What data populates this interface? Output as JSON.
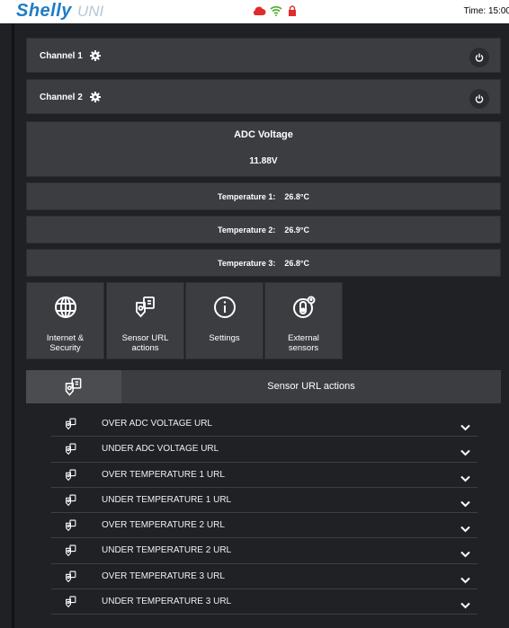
{
  "header": {
    "logo": "Shelly",
    "product": "UNI",
    "status_icons": [
      "cloud-icon",
      "wifi-icon",
      "lock-icon"
    ],
    "time_label": "Time: 15:00"
  },
  "channels": [
    {
      "label": "Channel 1"
    },
    {
      "label": "Channel 2"
    }
  ],
  "adc": {
    "title": "ADC Voltage",
    "value": "11.88V"
  },
  "temperatures": [
    {
      "label": "Temperature 1:",
      "value": "26.8°C"
    },
    {
      "label": "Temperature 2:",
      "value": "26.9°C"
    },
    {
      "label": "Temperature 3:",
      "value": "26.8°C"
    }
  ],
  "tiles": [
    {
      "icon": "globe-icon",
      "line1": "Internet &",
      "line2": "Security"
    },
    {
      "icon": "sensor-url-icon",
      "line1": "Sensor URL",
      "line2": "actions"
    },
    {
      "icon": "info-icon",
      "line1": "Settings",
      "line2": ""
    },
    {
      "icon": "external-sensor-icon",
      "line1": "External",
      "line2": "sensors"
    }
  ],
  "section": {
    "title": "Sensor URL actions"
  },
  "url_actions": [
    "OVER ADC VOLTAGE URL",
    "UNDER ADC VOLTAGE URL",
    "OVER TEMPERATURE 1 URL",
    "UNDER TEMPERATURE 1 URL",
    "OVER TEMPERATURE 2 URL",
    "UNDER TEMPERATURE 2 URL",
    "OVER TEMPERATURE 3 URL",
    "UNDER TEMPERATURE 3 URL"
  ],
  "colors": {
    "accent": "#1e7cc5",
    "panel": "#3b3d40",
    "background": "#1f2124"
  }
}
